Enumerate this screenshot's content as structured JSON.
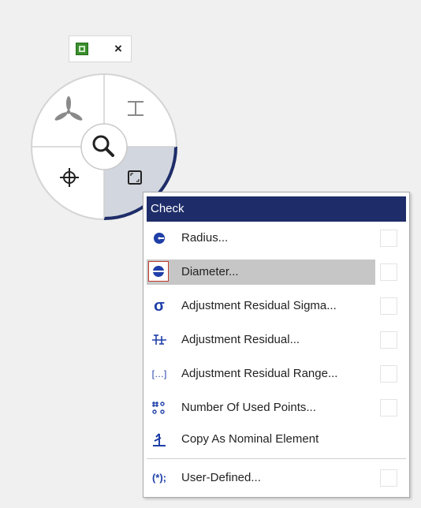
{
  "toolbar": {
    "close_label": "×"
  },
  "menu": {
    "header": "Check",
    "items": [
      {
        "label": "Radius...",
        "icon": "radius-icon"
      },
      {
        "label": "Diameter...",
        "icon": "diameter-icon",
        "selected": true
      },
      {
        "label": "Adjustment Residual Sigma...",
        "icon": "sigma-icon"
      },
      {
        "label": "Adjustment Residual...",
        "icon": "residual-icon"
      },
      {
        "label": "Adjustment Residual Range...",
        "icon": "residual-range-icon"
      },
      {
        "label": "Number Of Used Points...",
        "icon": "used-points-icon"
      },
      {
        "label": "Copy As Nominal Element",
        "icon": "copy-nominal-icon"
      },
      {
        "label": "User-Defined...",
        "icon": "user-defined-icon"
      }
    ],
    "glyphs": {
      "sigma": "σ",
      "range": "[…]",
      "user_defined": "(*);"
    }
  },
  "colors": {
    "header_bg": "#1e2d69",
    "icon_blue": "#1f3fa8",
    "wheel_accent": "#1e2d69",
    "selected_row": "#c6c6c6",
    "toolbar_green": "#3a8f2d"
  }
}
